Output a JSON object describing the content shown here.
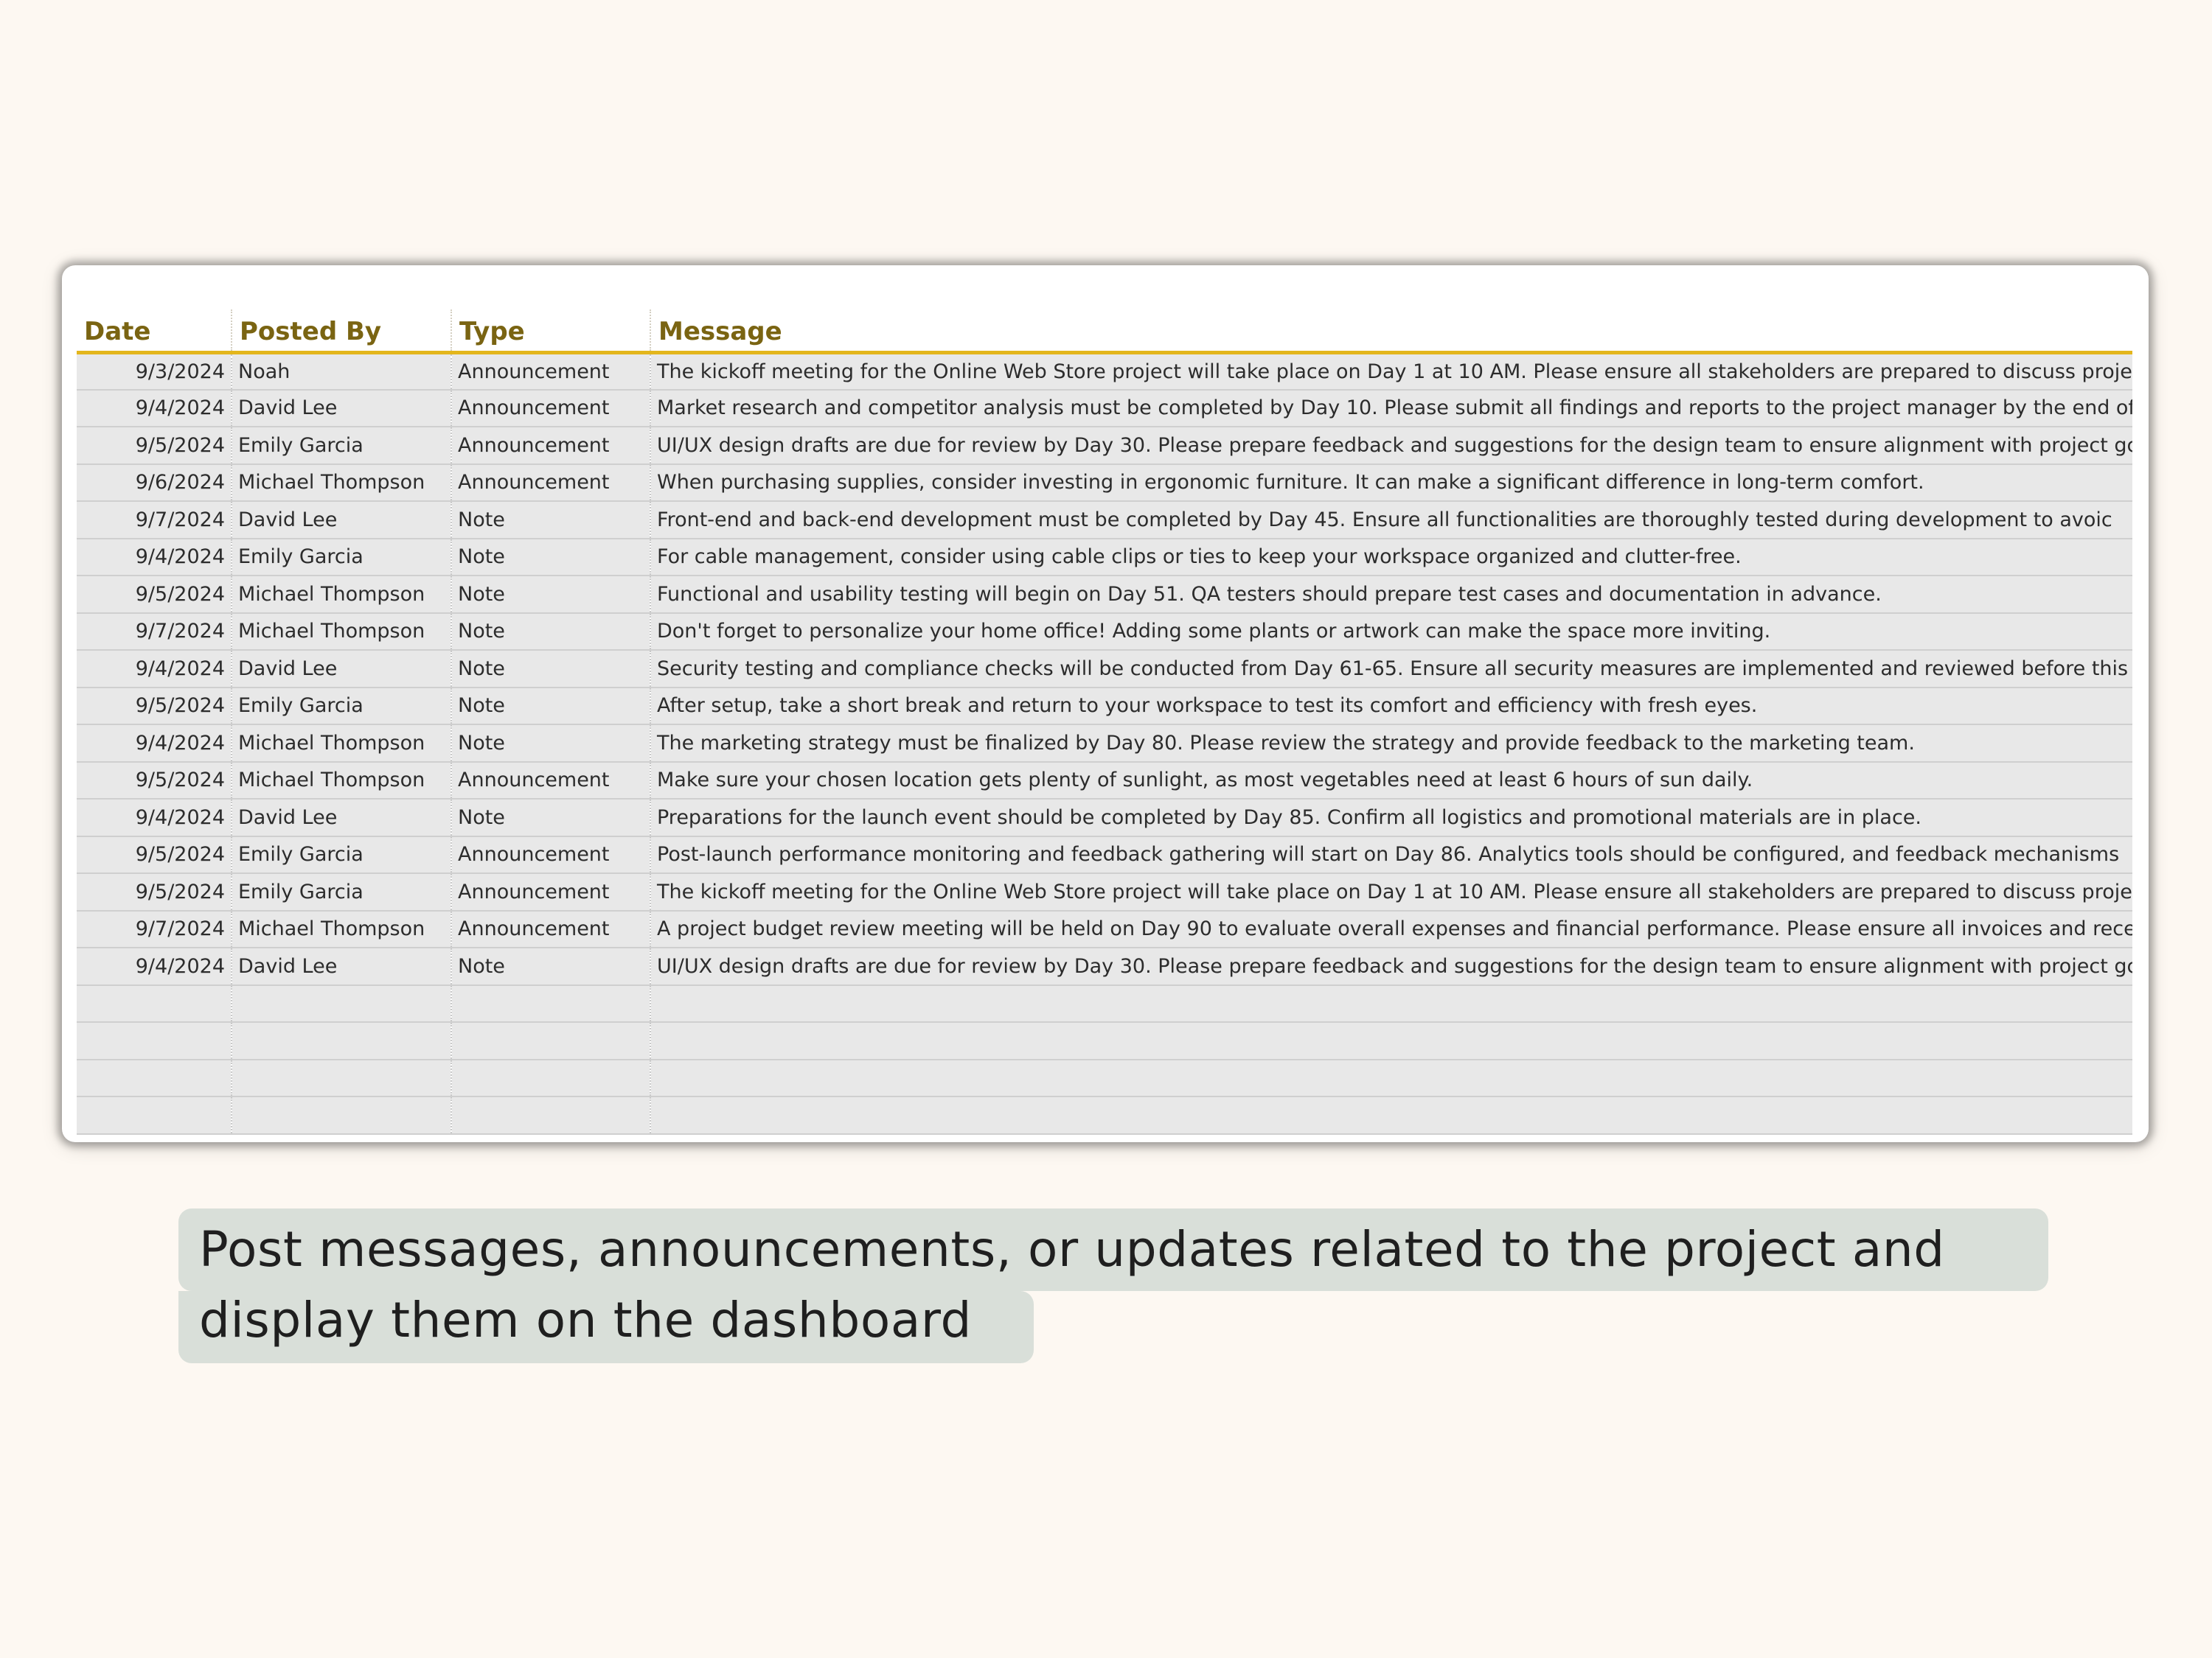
{
  "table": {
    "headers": {
      "date": "Date",
      "posted_by": "Posted By",
      "type": "Type",
      "message": "Message"
    },
    "rows": [
      {
        "date": "9/3/2024",
        "posted_by": "Noah",
        "type": "Announcement",
        "message": "The kickoff meeting for the Online Web Store project will take place on Day 1 at 10 AM. Please ensure all stakeholders are prepared to discuss projec"
      },
      {
        "date": "9/4/2024",
        "posted_by": "David Lee",
        "type": "Announcement",
        "message": "Market research and competitor analysis must be completed by Day 10. Please submit all findings and reports to the project manager by the end of"
      },
      {
        "date": "9/5/2024",
        "posted_by": "Emily Garcia",
        "type": "Announcement",
        "message": "UI/UX design drafts are due for review by Day 30. Please prepare feedback and suggestions for the design team to ensure alignment with project gc"
      },
      {
        "date": "9/6/2024",
        "posted_by": "Michael Thompson",
        "type": "Announcement",
        "message": "When purchasing supplies, consider investing in ergonomic furniture. It can make a significant difference in long-term comfort."
      },
      {
        "date": "9/7/2024",
        "posted_by": "David Lee",
        "type": "Note",
        "message": "Front-end and back-end development must be completed by Day 45. Ensure all functionalities are thoroughly tested during development to avoic"
      },
      {
        "date": "9/4/2024",
        "posted_by": "Emily Garcia",
        "type": "Note",
        "message": "For cable management, consider using cable clips or ties to keep your workspace organized and clutter-free."
      },
      {
        "date": "9/5/2024",
        "posted_by": "Michael Thompson",
        "type": "Note",
        "message": "Functional and usability testing will begin on Day 51. QA testers should prepare test cases and documentation in advance."
      },
      {
        "date": "9/7/2024",
        "posted_by": "Michael Thompson",
        "type": "Note",
        "message": "Don't forget to personalize your home office! Adding some plants or artwork can make the space more inviting."
      },
      {
        "date": "9/4/2024",
        "posted_by": "David Lee",
        "type": "Note",
        "message": "Security testing and compliance checks will be conducted from Day 61-65. Ensure all security measures are implemented and reviewed before this"
      },
      {
        "date": "9/5/2024",
        "posted_by": "Emily Garcia",
        "type": "Note",
        "message": "After setup, take a short break and return to your workspace to test its comfort and efficiency with fresh eyes."
      },
      {
        "date": "9/4/2024",
        "posted_by": "Michael Thompson",
        "type": "Note",
        "message": "The marketing strategy must be finalized by Day 80. Please review the strategy and provide feedback to the marketing team."
      },
      {
        "date": "9/5/2024",
        "posted_by": "Michael Thompson",
        "type": "Announcement",
        "message": "Make sure your chosen location gets plenty of sunlight, as most vegetables need at least 6 hours of sun daily."
      },
      {
        "date": "9/4/2024",
        "posted_by": "David Lee",
        "type": "Note",
        "message": "Preparations for the launch event should be completed by Day 85. Confirm all logistics and promotional materials are in place."
      },
      {
        "date": "9/5/2024",
        "posted_by": "Emily Garcia",
        "type": "Announcement",
        "message": "Post-launch performance monitoring and feedback gathering will start on Day 86. Analytics tools should be configured, and feedback mechanisms"
      },
      {
        "date": "9/5/2024",
        "posted_by": "Emily Garcia",
        "type": "Announcement",
        "message": "The kickoff meeting for the Online Web Store project will take place on Day 1 at 10 AM. Please ensure all stakeholders are prepared to discuss projec"
      },
      {
        "date": "9/7/2024",
        "posted_by": "Michael Thompson",
        "type": "Announcement",
        "message": "A project budget review meeting will be held on Day 90 to evaluate overall expenses and financial performance. Please ensure all invoices and rece"
      },
      {
        "date": "9/4/2024",
        "posted_by": "David Lee",
        "type": "Note",
        "message": "UI/UX design drafts are due for review by Day 30. Please prepare feedback and suggestions for the design team to ensure alignment with project gc"
      },
      {
        "date": "",
        "posted_by": "",
        "type": "",
        "message": ""
      },
      {
        "date": "",
        "posted_by": "",
        "type": "",
        "message": ""
      },
      {
        "date": "",
        "posted_by": "",
        "type": "",
        "message": ""
      },
      {
        "date": "",
        "posted_by": "",
        "type": "",
        "message": ""
      }
    ]
  },
  "caption": {
    "line1": "Post messages, announcements, or updates related to the project and",
    "line2": "display them on the dashboard"
  },
  "colors": {
    "background": "#fdf8f2",
    "header_text": "#7a6412",
    "accent_line": "#e3b61c",
    "row_fill": "#e8e8e8",
    "caption_fill": "#d9dfd9"
  }
}
